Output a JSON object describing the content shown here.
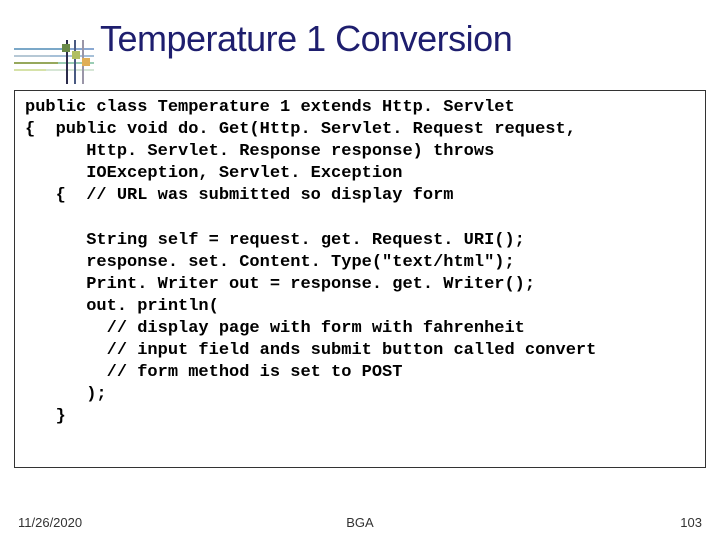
{
  "title": "Temperature 1 Conversion",
  "code": {
    "l01": "public class Temperature 1 extends Http. Servlet",
    "l02": "{  public void do. Get(Http. Servlet. Request request,",
    "l03": "      Http. Servlet. Response response) throws",
    "l04": "      IOException, Servlet. Exception",
    "l05": "   {  // URL was submitted so display form",
    "l06": "",
    "l07": "      String self = request. get. Request. URI();",
    "l08": "      response. set. Content. Type(\"text/html\");",
    "l09": "      Print. Writer out = response. get. Writer();",
    "l10": "      out. println(",
    "l11": "        // display page with form with fahrenheit",
    "l12": "        // input field ands submit button called convert",
    "l13": "        // form method is set to POST",
    "l14": "      );",
    "l15": "   }"
  },
  "footer": {
    "date": "11/26/2020",
    "center": "BGA",
    "page": "103"
  }
}
